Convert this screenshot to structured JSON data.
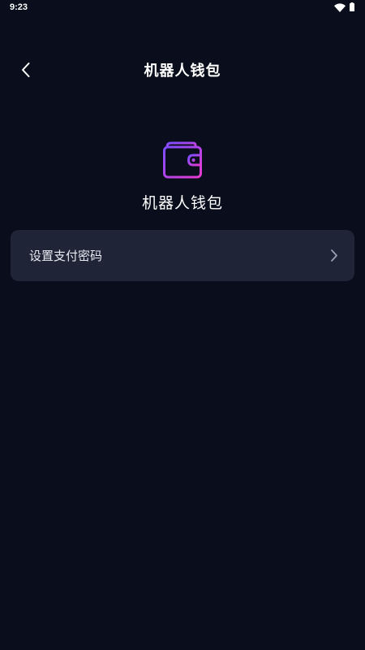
{
  "status_bar": {
    "time": "9:23",
    "icons": [
      "wifi-icon",
      "battery-icon"
    ]
  },
  "header": {
    "title": "机器人钱包",
    "back_icon": "chevron-left-icon"
  },
  "wallet": {
    "icon": "wallet-icon",
    "label": "机器人钱包",
    "gradient": [
      "#7b4dff",
      "#e63bcf"
    ]
  },
  "settings": {
    "items": [
      {
        "label": "设置支付密码",
        "icon": "chevron-right-icon"
      }
    ]
  },
  "colors": {
    "background": "#090d1c",
    "card": "#1f2436",
    "text": "#ffffff"
  }
}
